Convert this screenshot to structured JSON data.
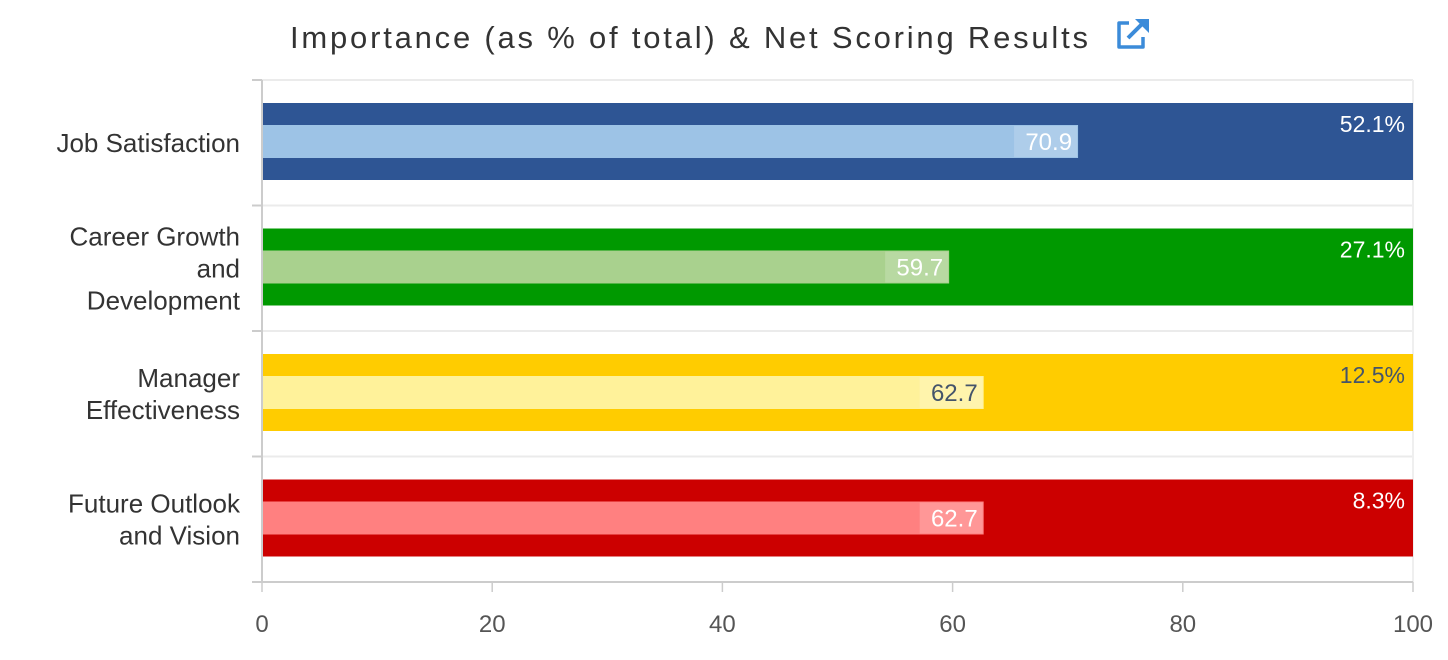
{
  "header": {
    "title": "Importance (as % of total) & Net Scoring Results",
    "action_icon": "external-link-icon",
    "icon_color": "#3b8bd9"
  },
  "chart_data": {
    "type": "bar",
    "orientation": "horizontal",
    "title": "Importance (as % of total) & Net Scoring Results",
    "xlabel": "",
    "ylabel": "",
    "xlim": [
      0,
      100
    ],
    "xticks": [
      0,
      20,
      40,
      60,
      80,
      100
    ],
    "xtick_labels": [
      "0",
      "20",
      "40",
      "60",
      "80",
      "100"
    ],
    "grid": true,
    "legend": "none",
    "categories": [
      "Job Satisfaction",
      "Career Growth and Development",
      "Manager Effectiveness",
      "Future Outlook and Vision"
    ],
    "category_label_lines": [
      [
        "Job Satisfaction"
      ],
      [
        "Career Growth",
        "and",
        "Development"
      ],
      [
        "Manager",
        "Effectiveness"
      ],
      [
        "Future Outlook",
        "and Vision"
      ]
    ],
    "series": [
      {
        "name": "Importance (as % of total)",
        "values": [
          52.1,
          27.1,
          12.5,
          8.3
        ],
        "labels": [
          "52.1%",
          "27.1%",
          "12.5%",
          "8.3%"
        ],
        "bar_extent": [
          100,
          100,
          100,
          100
        ]
      },
      {
        "name": "Net Scoring Results",
        "values": [
          70.9,
          59.7,
          62.7,
          62.7
        ],
        "labels": [
          "70.9",
          "59.7",
          "62.7",
          "62.7"
        ]
      }
    ],
    "colors": [
      {
        "outer": "#2e5594",
        "inner": "#9dc3e6",
        "pct_text": "#ffffff",
        "val_text": "#ffffff"
      },
      {
        "outer": "#009900",
        "inner": "#a9d18e",
        "pct_text": "#ffffff",
        "val_text": "#ffffff"
      },
      {
        "outer": "#ffcc00",
        "inner": "#fff29a",
        "pct_text": "#44546a",
        "val_text": "#44546a"
      },
      {
        "outer": "#cc0000",
        "inner": "#ff8080",
        "pct_text": "#ffffff",
        "val_text": "#ffffff"
      }
    ]
  }
}
